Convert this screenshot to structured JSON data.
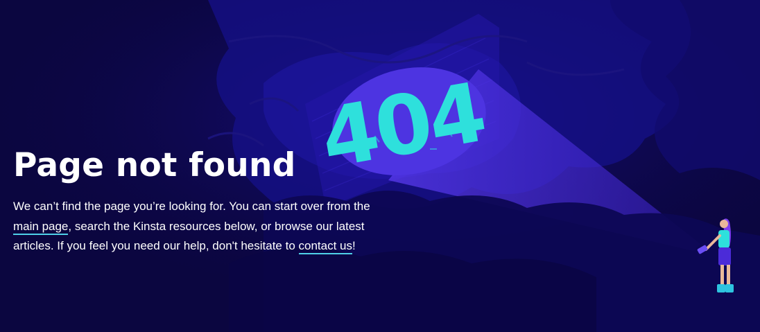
{
  "page": {
    "title": "Page not found",
    "message": {
      "part1": "We can’t find the page you’re looking for. You can start over from the ",
      "link1": "main page",
      "part2": ", search the Kinsta resources below, or browse our latest articles. If you feel you need our help, don't hesitate to ",
      "link2": "contact us",
      "part3": "!"
    }
  },
  "illustration": {
    "spotlight_text": "404",
    "icons": [
      "flashlight-icon"
    ]
  },
  "colors": {
    "background": "#0b0640",
    "accent": "#2ee0dc",
    "link_underline": "#4fd1e8",
    "beam": "#4a2fd6"
  }
}
